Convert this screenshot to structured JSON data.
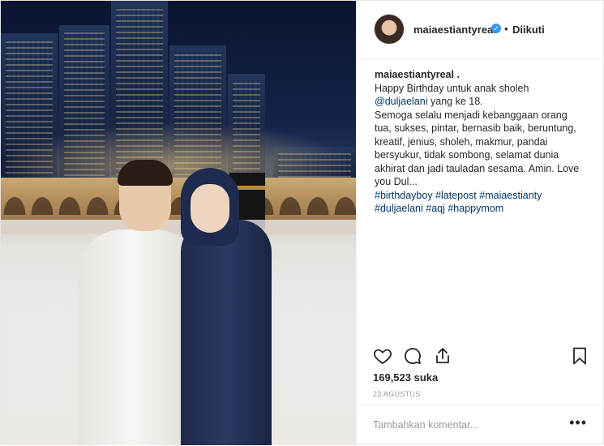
{
  "post": {
    "username": "maiaestiantyreal",
    "verified_icon": "verified-badge-icon",
    "separator": "•",
    "follow_status": "Diikuti"
  },
  "caption": {
    "username": "maiaestiantyreal .",
    "lines": [
      "Happy Birthday untuk anak sholeh",
      "@duljaelani",
      " yang ke 18.",
      "Semoga selalu menjadi kebanggaan orang",
      "tua, sukses, pintar, bernasib baik, beruntung,",
      "kreatif, jenius, sholeh, makmur, pandai",
      "bersyukur, tidak sombong, selamat dunia",
      "akhirat dan jadi tauladan sesama. Amin. Love",
      "you Dul...",
      "#birthdayboy #latepost #maiaestianty",
      "#duljaelani #aqj #happymom"
    ]
  },
  "actions": {
    "like_icon": "heart-icon",
    "comment_icon": "comment-icon",
    "share_icon": "share-icon",
    "save_icon": "bookmark-icon"
  },
  "likes": "169,523 suka",
  "date": "23 AGUSTUS",
  "comment": {
    "placeholder": "Tambahkan komentar...",
    "more": "•••"
  },
  "colors": {
    "link": "#003569",
    "verified": "#3897f0",
    "muted": "#999999",
    "text": "#262626"
  }
}
